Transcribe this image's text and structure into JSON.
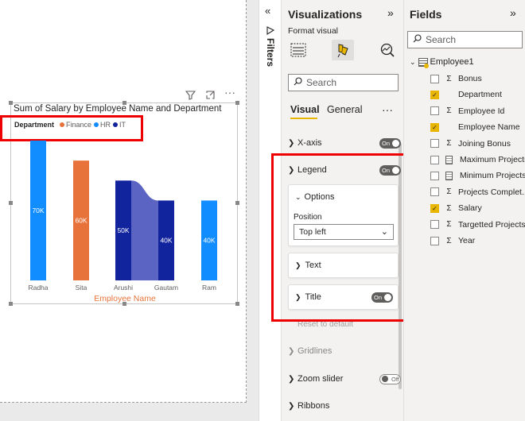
{
  "canvas": {
    "chart_title": "Sum of Salary by Employee Name and Department",
    "legend": {
      "title": "Department",
      "items": [
        {
          "label": "Finance",
          "color": "#e8733a"
        },
        {
          "label": "HR",
          "color": "#118dff"
        },
        {
          "label": "IT",
          "color": "#12239e"
        }
      ]
    },
    "x_axis_title": "Employee Name",
    "header_icons": [
      "filter-icon",
      "focus-mode-icon",
      "more-options-icon"
    ]
  },
  "chart_data": {
    "type": "bar",
    "title": "Sum of Salary by Employee Name and Department",
    "xlabel": "Employee Name",
    "ylabel": "",
    "categories": [
      "Radha",
      "Sita",
      "Arushi",
      "Gautam",
      "Ram"
    ],
    "series": [
      {
        "name": "Finance",
        "values": [
          null,
          60000,
          null,
          null,
          null
        ]
      },
      {
        "name": "HR",
        "values": [
          70000,
          null,
          null,
          null,
          40000
        ]
      },
      {
        "name": "IT",
        "values": [
          null,
          null,
          50000,
          40000,
          null
        ]
      }
    ],
    "data_labels": [
      "70K",
      "60K",
      "50K",
      "40K",
      "40K"
    ],
    "bar_colors": [
      "#118dff",
      "#e8733a",
      "#12239e",
      "#12239e",
      "#118dff"
    ],
    "ribbon": true,
    "legend_position": "top-left",
    "ylim": [
      0,
      72000
    ]
  },
  "filters": {
    "label": "Filters",
    "collapse_glyph": "«"
  },
  "visualizations": {
    "title": "Visualizations",
    "collapse_glyph": "»",
    "format_label": "Format visual",
    "search_placeholder": "Search",
    "tabs": {
      "visual": "Visual",
      "general": "General"
    },
    "more": "···",
    "sections": {
      "x_axis": {
        "label": "X-axis",
        "toggle": "On"
      },
      "legend": {
        "label": "Legend",
        "toggle": "On"
      },
      "options": {
        "label": "Options",
        "position_label": "Position",
        "position_value": "Top left"
      },
      "text": {
        "label": "Text"
      },
      "title": {
        "label": "Title",
        "toggle": "On"
      },
      "reset": "Reset to default",
      "gridlines": {
        "label": "Gridlines"
      },
      "zoom_slider": {
        "label": "Zoom slider",
        "toggle": "Off"
      },
      "ribbons": {
        "label": "Ribbons"
      }
    }
  },
  "fields": {
    "title": "Fields",
    "collapse_glyph": "»",
    "search_placeholder": "Search",
    "table": "Employee1",
    "items": [
      {
        "label": "Bonus",
        "checked": false,
        "type": "sum"
      },
      {
        "label": "Department",
        "checked": true,
        "type": "text"
      },
      {
        "label": "Employee Id",
        "checked": false,
        "type": "sum"
      },
      {
        "label": "Employee Name",
        "checked": true,
        "type": "text"
      },
      {
        "label": "Joining Bonus",
        "checked": false,
        "type": "sum"
      },
      {
        "label": "Maximum Projects",
        "checked": false,
        "type": "calc"
      },
      {
        "label": "Minimum Projects",
        "checked": false,
        "type": "calc"
      },
      {
        "label": "Projects Complet...",
        "checked": false,
        "type": "sum"
      },
      {
        "label": "Salary",
        "checked": true,
        "type": "sum"
      },
      {
        "label": "Targetted Projects",
        "checked": false,
        "type": "sum"
      },
      {
        "label": "Year",
        "checked": false,
        "type": "sum"
      }
    ]
  }
}
